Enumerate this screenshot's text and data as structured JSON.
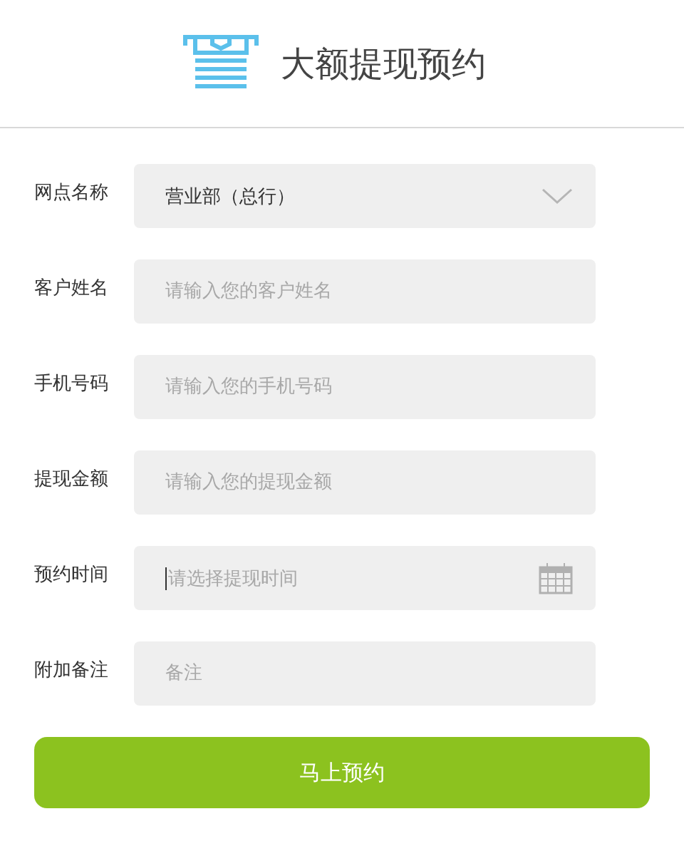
{
  "header": {
    "title": "大额提现预约"
  },
  "fields": [
    {
      "kind": "select",
      "label": "网点名称",
      "value": "营业部（总行）"
    },
    {
      "kind": "text",
      "label": "客户姓名",
      "placeholder": "请输入您的客户姓名"
    },
    {
      "kind": "text",
      "label": "手机号码",
      "placeholder": "请输入您的手机号码"
    },
    {
      "kind": "text",
      "label": "提现金额",
      "placeholder": "请输入您的提现金额"
    },
    {
      "kind": "date",
      "label": "预约时间",
      "placeholder": "请选择提现时间",
      "focused": true
    },
    {
      "kind": "text",
      "label": "附加备注",
      "placeholder": "备注"
    }
  ],
  "submit": {
    "label": "马上预约"
  }
}
